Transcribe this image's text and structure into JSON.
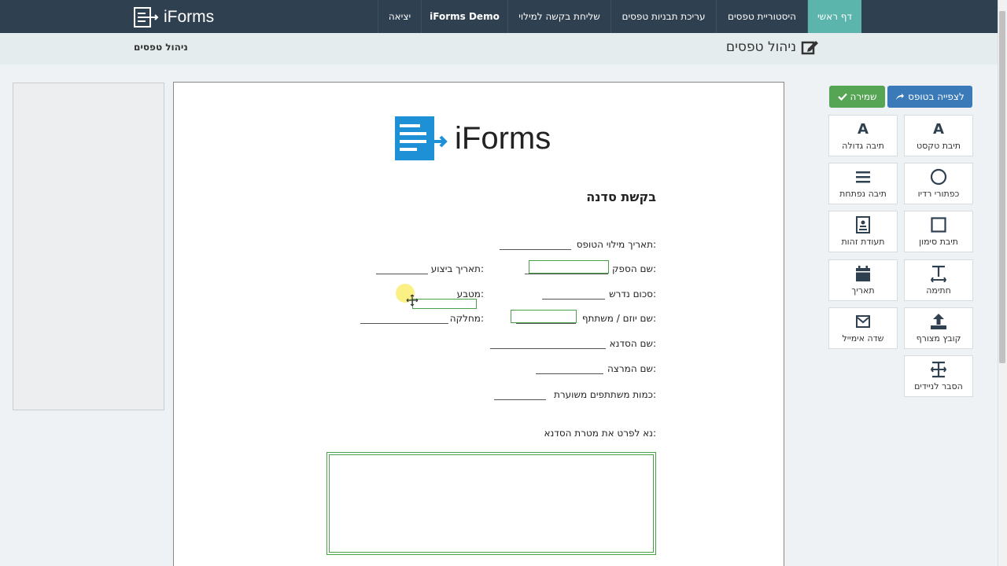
{
  "nav": {
    "brand": "iForms",
    "items": [
      {
        "label": "דף ראשי",
        "active": true
      },
      {
        "label": "היסטוריית טפסים",
        "active": false
      },
      {
        "label": "עריכת תבניות טפסים",
        "active": false
      },
      {
        "label": "שליחת בקשה למילוי",
        "active": false
      },
      {
        "label": "iForms Demo",
        "active": false
      },
      {
        "label": "יציאה",
        "active": false
      }
    ]
  },
  "subheader": {
    "breadcrumb": "ניהול טפסים",
    "title": "ניהול טפסים",
    "title_icon": "edit-icon"
  },
  "toolbar": {
    "preview_label": "לצפייה בטופס",
    "save_label": "שמירה",
    "tools": [
      {
        "label": "תיבת טקסט",
        "icon": "text-a-icon"
      },
      {
        "label": "תיבה גדולה",
        "icon": "large-text-a-icon"
      },
      {
        "label": "כפתורי רדיו",
        "icon": "radio-circle-icon"
      },
      {
        "label": "תיבה נפתחת",
        "icon": "dropdown-list-icon"
      },
      {
        "label": "תיבת סימון",
        "icon": "checkbox-icon"
      },
      {
        "label": "תעודת זהות",
        "icon": "id-card-icon"
      },
      {
        "label": "חתימה",
        "icon": "signature-icon"
      },
      {
        "label": "תאריך",
        "icon": "calendar-icon"
      },
      {
        "label": "קובץ מצורף",
        "icon": "upload-icon"
      },
      {
        "label": "שדה אימייל",
        "icon": "envelope-icon"
      },
      {
        "label": "הסבר לניידים",
        "icon": "mobile-text-icon"
      }
    ]
  },
  "form": {
    "logo_text": "iForms",
    "title": "בקשת סדנה",
    "fields": {
      "fill_date": "תאריך מילוי הטופס:",
      "supplier_name": "שם הספק:",
      "execution_date": "תאריך ביצוע:",
      "amount": "סכום נדרש:",
      "currency": "מטבע:",
      "initiator": "שם יוזם / משתתף:",
      "department": "מחלקה:",
      "workshop_name": "שם הסדנא:",
      "lecturer": "שם המרצה:",
      "participants": "כמות משתתפים משוערת:",
      "purpose": "נא לפרט את מטרת הסדנא:"
    }
  },
  "colors": {
    "nav_bg": "#2f4050",
    "nav_active": "#5bb5ad",
    "preview_btn": "#3a7ab8",
    "save_btn": "#55a555",
    "field_border": "#4aa04a",
    "logo_blue": "#1e90d6"
  }
}
